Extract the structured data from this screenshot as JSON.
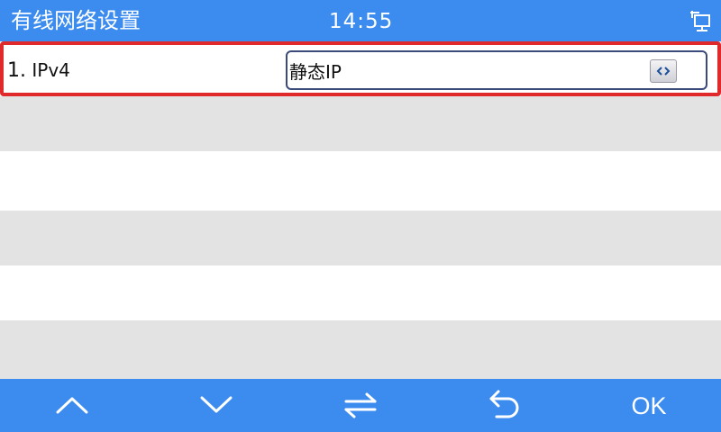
{
  "header": {
    "title": "有线网络设置",
    "time": "14:55",
    "status_icon": "network-lan-icon"
  },
  "rows": [
    {
      "number": "1.",
      "label": "IPv4",
      "value": "静态IP",
      "selected": true,
      "toggle_icon": "left-right-toggle-icon"
    }
  ],
  "footer": {
    "buttons": [
      {
        "icon": "chevron-up-icon"
      },
      {
        "icon": "chevron-down-icon"
      },
      {
        "icon": "switch-arrows-icon"
      },
      {
        "icon": "back-return-icon"
      },
      {
        "label": "OK"
      }
    ]
  },
  "colors": {
    "bar_blue": "#3c8cf0",
    "selection_red": "#e0292b",
    "row_grey": "#e3e3e3"
  }
}
